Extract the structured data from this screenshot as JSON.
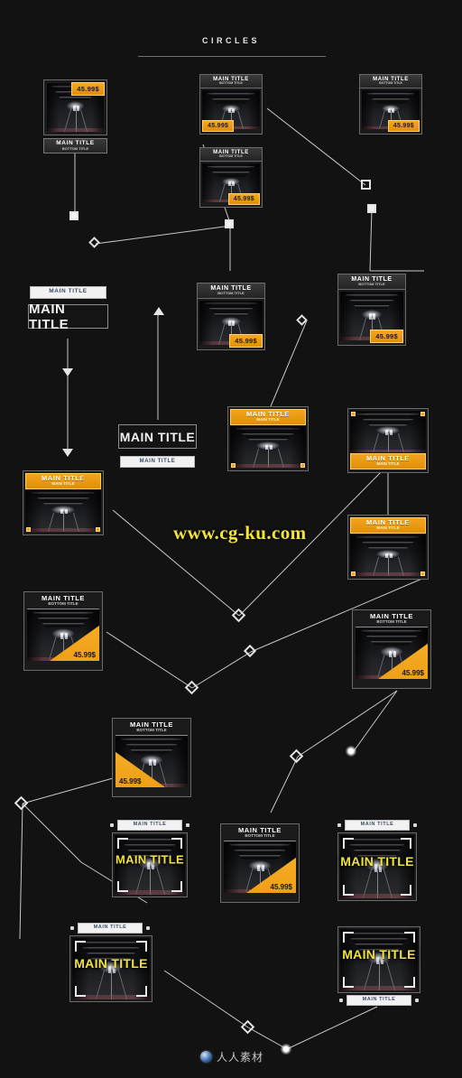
{
  "header": {
    "title": "CIRCLES"
  },
  "labels": {
    "main_title": "MAIN TITLE",
    "bottom_title": "BOTTOM TITLE",
    "price": "45.99$"
  },
  "watermarks": {
    "url": "www.cg-ku.com",
    "brand_cn": "人人素材"
  },
  "colors": {
    "background": "#121212",
    "accent_orange": "#f0a61c",
    "accent_yellow": "#f2e23c",
    "frame_border": "#6a6a6a",
    "wire": "#c8c8c8"
  },
  "cards": [
    {
      "id": "c01",
      "main": "MAIN TITLE",
      "sub": "BOTTOM TITLE",
      "price": "45.99$",
      "variant": "badge-top-right / strip-below"
    },
    {
      "id": "c02",
      "main": "MAIN TITLE",
      "sub": "BOTTOM TITLE",
      "price": "45.99$",
      "variant": "strip-top / badge-bottom-left"
    },
    {
      "id": "c03",
      "main": "MAIN TITLE",
      "sub": "BOTTOM TITLE",
      "price": "45.99$",
      "variant": "strip-top / badge-bottom-right"
    },
    {
      "id": "c04",
      "main": "MAIN TITLE",
      "sub": "BOTTOM TITLE",
      "price": "45.99$",
      "variant": "strip-top / badge-bottom-right"
    },
    {
      "id": "c05",
      "main": "MAIN TITLE",
      "sub": "BOTTOM TITLE",
      "price": "45.99$",
      "variant": "strip-top / badge-bottom-right"
    },
    {
      "id": "c06",
      "main": "MAIN TITLE",
      "sub": "BOTTOM TITLE",
      "price": "45.99$",
      "variant": "strip-top / badge-bottom-right"
    },
    {
      "id": "c07",
      "main": "MAIN TITLE",
      "sub": "",
      "price": "",
      "variant": "text-strip-white-small"
    },
    {
      "id": "c08",
      "main": "MAIN TITLE",
      "sub": "",
      "price": "",
      "variant": "text-box-large-dark"
    },
    {
      "id": "c09",
      "main": "MAIN TITLE",
      "sub": "",
      "price": "",
      "variant": "text-box-large-dark"
    },
    {
      "id": "c10",
      "main": "MAIN TITLE",
      "sub": "",
      "price": "",
      "variant": "text-strip-white-small"
    },
    {
      "id": "c11",
      "main": "MAIN TITLE",
      "sub": "MAIN TITLE",
      "price": "",
      "variant": "orange-strip-top / corner-dots-bottom"
    },
    {
      "id": "c12",
      "main": "MAIN TITLE",
      "sub": "MAIN TITLE",
      "price": "",
      "variant": "orange-strip-bottom / corner-dots-top"
    },
    {
      "id": "c13",
      "main": "MAIN TITLE",
      "sub": "MAIN TITLE",
      "price": "",
      "variant": "orange-strip-top / corner-dots-bottom"
    },
    {
      "id": "c14",
      "main": "MAIN TITLE",
      "sub": "MAIN TITLE",
      "price": "",
      "variant": "orange-strip-top / corner-dots-bottom"
    },
    {
      "id": "c15",
      "main": "MAIN TITLE",
      "sub": "BOTTOM TITLE",
      "price": "45.99$",
      "variant": "strip-top / diagonal-corner-bottom-right"
    },
    {
      "id": "c16",
      "main": "MAIN TITLE",
      "sub": "BOTTOM TITLE",
      "price": "45.99$",
      "variant": "strip-top / diagonal-corner-bottom-right"
    },
    {
      "id": "c17",
      "main": "MAIN TITLE",
      "sub": "BOTTOM TITLE",
      "price": "45.99$",
      "variant": "strip-top / diagonal-corner-bottom-left"
    },
    {
      "id": "c18",
      "main": "MAIN TITLE",
      "sub": "BOTTOM TITLE",
      "price": "45.99$",
      "variant": "strip-top / diagonal-corner-bottom-right"
    },
    {
      "id": "c19",
      "main": "MAIN TITLE",
      "sub": "",
      "price": "",
      "variant": "tab-above / yellow-overlay / brackets"
    },
    {
      "id": "c20",
      "main": "MAIN TITLE",
      "sub": "",
      "price": "",
      "variant": "tab-above / yellow-overlay / brackets"
    },
    {
      "id": "c21",
      "main": "MAIN TITLE",
      "sub": "",
      "price": "",
      "variant": "tab-above / yellow-overlay / brackets"
    },
    {
      "id": "c22",
      "main": "MAIN TITLE",
      "sub": "",
      "price": "",
      "variant": "yellow-overlay / brackets / tab-below"
    }
  ]
}
